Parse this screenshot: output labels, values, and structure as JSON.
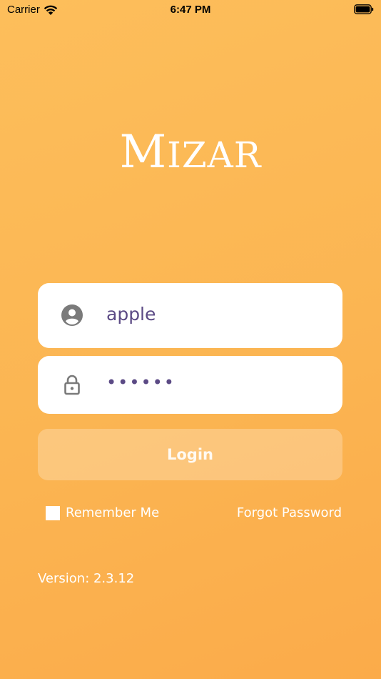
{
  "status_bar": {
    "carrier": "Carrier",
    "time": "6:47 PM",
    "wifi_icon": "wifi-icon",
    "battery_icon": "battery-icon"
  },
  "logo": {
    "first_letter": "M",
    "rest": "IZAR"
  },
  "username": {
    "icon": "person-icon",
    "value": "apple"
  },
  "password": {
    "icon": "lock-icon",
    "value": "••••••"
  },
  "login_button": {
    "label": "Login"
  },
  "remember_me": {
    "label": "Remember Me",
    "checked": false
  },
  "forgot_password": {
    "label": "Forgot Password"
  },
  "version": {
    "text": "Version: 2.3.12"
  },
  "colors": {
    "background": "#fbb552",
    "field_text": "#5b4a85",
    "icon_gray": "#777777"
  }
}
